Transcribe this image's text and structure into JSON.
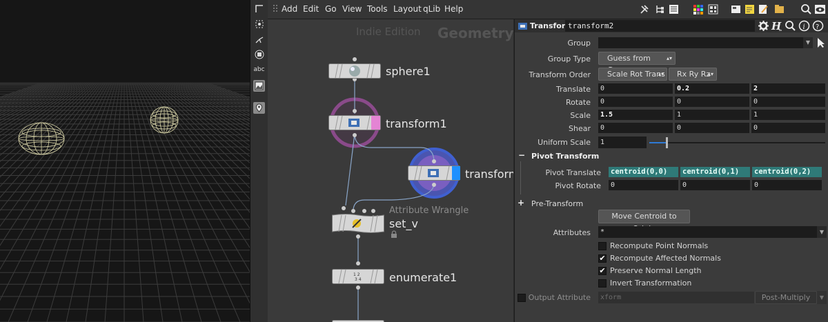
{
  "menu": [
    "Add",
    "Edit",
    "Go",
    "View",
    "Tools",
    "Layout",
    "qLib",
    "Help"
  ],
  "left_toolbar": {
    "text_tool_label": "abc"
  },
  "network": {
    "edition": "Indie Edition",
    "context": "Geometry",
    "nodes": {
      "sphere": "sphere1",
      "transform1": "transform1",
      "transform2": "transform",
      "wrangle_type": "Attribute Wrangle",
      "wrangle_name": "set_v",
      "enumerate": "enumerate1"
    }
  },
  "params": {
    "node_type": "Transform",
    "node_name": "transform2",
    "group_label": "Group",
    "group_value": "",
    "group_type_label": "Group Type",
    "group_type_value": "Guess from Group",
    "transform_order_label": "Transform Order",
    "transform_order_value": "Scale Rot Trans",
    "rotation_order_value": "Rx Ry Rz",
    "translate_label": "Translate",
    "translate": [
      "0",
      "0.2",
      "2"
    ],
    "rotate_label": "Rotate",
    "rotate": [
      "0",
      "0",
      "0"
    ],
    "scale_label": "Scale",
    "scale": [
      "1.5",
      "1",
      "1"
    ],
    "shear_label": "Shear",
    "shear": [
      "0",
      "0",
      "0"
    ],
    "uniform_scale_label": "Uniform Scale",
    "uniform_scale": "1",
    "pivot_section": "Pivot Transform",
    "pivot_translate_label": "Pivot Translate",
    "pivot_translate": [
      "centroid(0,0)",
      "centroid(0,1)",
      "centroid(0,2)"
    ],
    "pivot_rotate_label": "Pivot Rotate",
    "pivot_rotate": [
      "0",
      "0",
      "0"
    ],
    "pretransform_section": "Pre-Transform",
    "move_centroid_label": "Move Centroid to Origin",
    "attributes_label": "Attributes",
    "attributes_value": "*",
    "recompute_point_normals": "Recompute Point Normals",
    "recompute_affected_normals": "Recompute Affected Normals",
    "preserve_normal_length": "Preserve Normal Length",
    "invert_transformation": "Invert Transformation",
    "output_attribute_label": "Output Attribute",
    "output_attribute_value": "xform",
    "post_multiply": "Post-Multiply"
  },
  "colors": {
    "expression": "#2f7a78",
    "selection_blue": "#1e90ff",
    "transform_ring": "#8a4a8a",
    "transform2_ring": "#4060d0"
  }
}
